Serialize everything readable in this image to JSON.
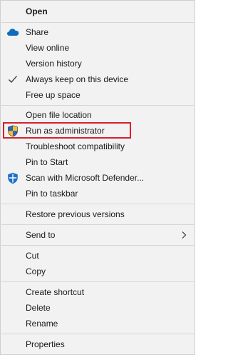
{
  "menu": {
    "open": "Open",
    "share": "Share",
    "view_online": "View online",
    "version_history": "Version history",
    "always_keep": "Always keep on this device",
    "free_up_space": "Free up space",
    "open_file_location": "Open file location",
    "run_as_admin": "Run as administrator",
    "troubleshoot": "Troubleshoot compatibility",
    "pin_to_start": "Pin to Start",
    "scan_defender": "Scan with Microsoft Defender...",
    "pin_to_taskbar": "Pin to taskbar",
    "restore_previous": "Restore previous versions",
    "send_to": "Send to",
    "cut": "Cut",
    "copy": "Copy",
    "create_shortcut": "Create shortcut",
    "delete": "Delete",
    "rename": "Rename",
    "properties": "Properties"
  },
  "icons": {
    "share": "onedrive-cloud-icon",
    "always_keep": "checkmark-icon",
    "run_as_admin": "uac-shield-icon",
    "scan_defender": "defender-shield-icon",
    "send_to": "chevron-right-icon"
  },
  "colors": {
    "menu_background": "#f2f2f2",
    "highlight_border": "#d8202a",
    "onedrive_blue": "#0f6cbd"
  }
}
